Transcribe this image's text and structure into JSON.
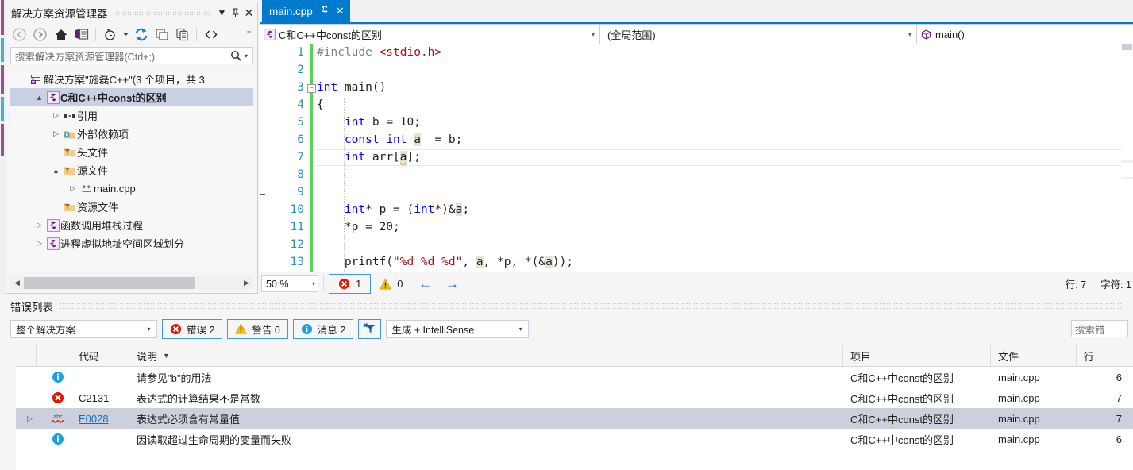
{
  "solution_explorer": {
    "title": "解决方案资源管理器",
    "window_buttons": {
      "dropdown": "▼",
      "pin": "⚲",
      "close": "✕",
      "overflow": "''"
    },
    "toolbar": [
      {
        "name": "back-icon",
        "label": "后退"
      },
      {
        "name": "forward-icon",
        "label": "前进"
      },
      {
        "name": "home-icon",
        "label": "主页"
      },
      {
        "name": "solution-view-icon",
        "label": "解决方案视图"
      },
      {
        "name": "pending-changes-icon",
        "label": "挂起的更改筛选器"
      },
      {
        "name": "refresh-icon",
        "label": "刷新"
      },
      {
        "name": "collapse-all-icon",
        "label": "全部折叠"
      },
      {
        "name": "properties-icon",
        "label": "属性"
      },
      {
        "name": "show-all-files-icon",
        "label": "显示所有文件"
      }
    ],
    "search": {
      "placeholder": "搜索解决方案资源管理器(Ctrl+;)",
      "icon": "search-icon"
    },
    "tree": [
      {
        "label": "解决方案\"施磊C++\"(3 个项目，共 3",
        "icon": "solution-icon",
        "indent": 0,
        "twisty": "",
        "selected": false,
        "bold": false
      },
      {
        "label": "C和C++中const的区别",
        "icon": "cpp-project-icon",
        "indent": 1,
        "twisty": "▲",
        "selected": true,
        "bold": true
      },
      {
        "label": "引用",
        "icon": "references-icon",
        "indent": 2,
        "twisty": "▷",
        "selected": false,
        "bold": false
      },
      {
        "label": "外部依赖项",
        "icon": "external-deps-icon",
        "indent": 2,
        "twisty": "▷",
        "selected": false,
        "bold": false
      },
      {
        "label": "头文件",
        "icon": "filter-folder-icon",
        "indent": 2,
        "twisty": "",
        "selected": false,
        "bold": false
      },
      {
        "label": "源文件",
        "icon": "filter-folder-icon",
        "indent": 2,
        "twisty": "▲",
        "selected": false,
        "bold": false
      },
      {
        "label": "main.cpp",
        "icon": "cpp-file-icon",
        "indent": 3,
        "twisty": "▷",
        "selected": false,
        "bold": false
      },
      {
        "label": "资源文件",
        "icon": "filter-folder-icon",
        "indent": 2,
        "twisty": "",
        "selected": false,
        "bold": false
      },
      {
        "label": "函数调用堆栈过程",
        "icon": "cpp-project-icon",
        "indent": 1,
        "twisty": "▷",
        "selected": false,
        "bold": false
      },
      {
        "label": "进程虚拟地址空间区域划分",
        "icon": "cpp-project-icon",
        "indent": 1,
        "twisty": "▷",
        "selected": false,
        "bold": false
      }
    ]
  },
  "editor": {
    "tab": {
      "title": "main.cpp",
      "pin": "⚲",
      "close": "✕"
    },
    "navbar": {
      "project": "C和C++中const的区别",
      "project_icon": "cpp-project-icon",
      "scope": "(全局范围)",
      "member": "main()",
      "member_icon": "method-icon",
      "chevron": "▾"
    },
    "lines": [
      {
        "n": "1",
        "tokens": [
          {
            "t": "#include ",
            "c": "pp"
          },
          {
            "t": "<stdio.h>",
            "c": "str"
          }
        ]
      },
      {
        "n": "2",
        "tokens": []
      },
      {
        "n": "3",
        "tokens": [
          {
            "t": "int",
            "c": "kw"
          },
          {
            "t": " main()",
            "c": ""
          }
        ],
        "fold": true
      },
      {
        "n": "4",
        "tokens": [
          {
            "t": "{",
            "c": ""
          }
        ]
      },
      {
        "n": "5",
        "tokens": [
          {
            "t": "    ",
            "c": ""
          },
          {
            "t": "int",
            "c": "kw"
          },
          {
            "t": " b = ",
            "c": ""
          },
          {
            "t": "10",
            "c": "num"
          },
          {
            "t": ";",
            "c": ""
          }
        ]
      },
      {
        "n": "6",
        "tokens": [
          {
            "t": "    ",
            "c": ""
          },
          {
            "t": "const",
            "c": "kw"
          },
          {
            "t": " ",
            "c": ""
          },
          {
            "t": "int",
            "c": "kw"
          },
          {
            "t": " ",
            "c": ""
          },
          {
            "t": "a",
            "c": "hl"
          },
          {
            "t": "  = b;",
            "c": ""
          }
        ]
      },
      {
        "n": "7",
        "tokens": [
          {
            "t": "    ",
            "c": ""
          },
          {
            "t": "int",
            "c": "kw"
          },
          {
            "t": " arr[",
            "c": ""
          },
          {
            "t": "a",
            "c": "hl sq"
          },
          {
            "t": "];",
            "c": ""
          }
        ],
        "current": true
      },
      {
        "n": "8",
        "tokens": []
      },
      {
        "n": "9",
        "tokens": []
      },
      {
        "n": "10",
        "tokens": [
          {
            "t": "    ",
            "c": ""
          },
          {
            "t": "int",
            "c": "kw"
          },
          {
            "t": "* p = (",
            "c": ""
          },
          {
            "t": "int",
            "c": "kw"
          },
          {
            "t": "*)&",
            "c": ""
          },
          {
            "t": "a",
            "c": "hl"
          },
          {
            "t": ";",
            "c": ""
          }
        ]
      },
      {
        "n": "11",
        "tokens": [
          {
            "t": "    *p = ",
            "c": ""
          },
          {
            "t": "20",
            "c": "num"
          },
          {
            "t": ";",
            "c": ""
          }
        ]
      },
      {
        "n": "12",
        "tokens": []
      },
      {
        "n": "13",
        "tokens": [
          {
            "t": "    printf(",
            "c": ""
          },
          {
            "t": "\"%d %d %d\"",
            "c": "str"
          },
          {
            "t": ", ",
            "c": ""
          },
          {
            "t": "a",
            "c": "hl"
          },
          {
            "t": ", *p, *(&",
            "c": ""
          },
          {
            "t": "a",
            "c": "hl"
          },
          {
            "t": "));",
            "c": ""
          }
        ]
      }
    ],
    "status": {
      "zoom": "50 %",
      "zoom_chevron": "▾",
      "error_count": "1",
      "warning_count": "0",
      "prev_arrow": "←",
      "next_arrow": "→",
      "line": "行: 7",
      "col": "字符: 1"
    }
  },
  "error_list": {
    "title": "错误列表",
    "scope_filter": "整个解决方案",
    "scope_chevron": "▾",
    "errors_toggle": "错误 2",
    "warnings_toggle": "警告 0",
    "messages_toggle": "消息 2",
    "clear_filter_icon": "clear-filter-icon",
    "build_filter": "生成 + IntelliSense",
    "build_chevron": "▾",
    "search_placeholder": "搜索错",
    "columns": {
      "expander": "",
      "icon": "",
      "code": "代码",
      "description": "说明",
      "sort_glyph": "▼",
      "project": "项目",
      "file": "文件",
      "line": "行"
    },
    "rows": [
      {
        "severity": "info",
        "icon": "info-icon",
        "code": "",
        "code_link": false,
        "description": "请参见\"b\"的用法",
        "project": "C和C++中const的区别",
        "file": "main.cpp",
        "line": "6",
        "selected": false,
        "expander": ""
      },
      {
        "severity": "error",
        "icon": "error-icon",
        "code": "C2131",
        "code_link": false,
        "description": "表达式的计算结果不是常数",
        "project": "C和C++中const的区别",
        "file": "main.cpp",
        "line": "7",
        "selected": false,
        "expander": ""
      },
      {
        "severity": "intellisense",
        "icon": "squiggle-abc-icon",
        "code": "E0028",
        "code_link": true,
        "description": "表达式必须含有常量值",
        "project": "C和C++中const的区别",
        "file": "main.cpp",
        "line": "7",
        "selected": true,
        "expander": "▷"
      },
      {
        "severity": "info",
        "icon": "info-icon",
        "code": "",
        "code_link": false,
        "description": "因读取超过生命周期的变量而失败",
        "project": "C和C++中const的区别",
        "file": "main.cpp",
        "line": "6",
        "selected": false,
        "expander": ""
      }
    ]
  },
  "colors": {
    "accent": "#007acc",
    "error": "#e51400",
    "warning": "#f6c000",
    "info": "#1ba1e2",
    "selection": "#c9d0e4",
    "keyword": "#0000ff",
    "string": "#a31515",
    "linenumber": "#2b91af",
    "changebar": "#57d357"
  }
}
